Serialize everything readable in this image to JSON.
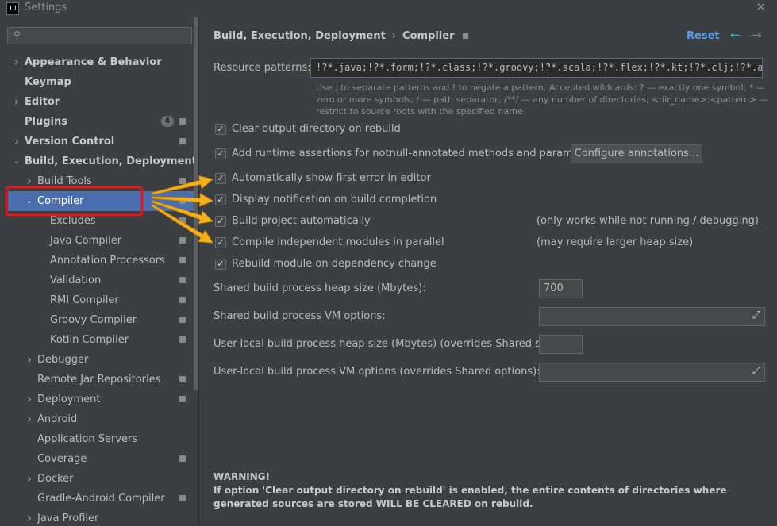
{
  "window": {
    "title": "Settings",
    "app_icon_text": "IJ"
  },
  "sidebar": {
    "search": {
      "placeholder": "",
      "icon": "search-icon"
    },
    "items": [
      {
        "label": "Appearance & Behavior",
        "level": 0,
        "arrow": "right",
        "bold": true
      },
      {
        "label": "Keymap",
        "level": 0,
        "arrow": "",
        "bold": true
      },
      {
        "label": "Editor",
        "level": 0,
        "arrow": "right",
        "bold": true
      },
      {
        "label": "Plugins",
        "level": 0,
        "arrow": "",
        "bold": true,
        "badge": "4",
        "project": true
      },
      {
        "label": "Version Control",
        "level": 0,
        "arrow": "right",
        "bold": true,
        "project": true
      },
      {
        "label": "Build, Execution, Deployment",
        "level": 0,
        "arrow": "down",
        "bold": true
      },
      {
        "label": "Build Tools",
        "level": 1,
        "arrow": "right",
        "project": true
      },
      {
        "label": "Compiler",
        "level": 1,
        "arrow": "down",
        "selected": true,
        "project": true
      },
      {
        "label": "Excludes",
        "level": 2,
        "arrow": "",
        "project": true
      },
      {
        "label": "Java Compiler",
        "level": 2,
        "arrow": "",
        "project": true
      },
      {
        "label": "Annotation Processors",
        "level": 2,
        "arrow": "",
        "project": true
      },
      {
        "label": "Validation",
        "level": 2,
        "arrow": "",
        "project": true
      },
      {
        "label": "RMI Compiler",
        "level": 2,
        "arrow": "",
        "project": true
      },
      {
        "label": "Groovy Compiler",
        "level": 2,
        "arrow": "",
        "project": true
      },
      {
        "label": "Kotlin Compiler",
        "level": 2,
        "arrow": "",
        "project": true
      },
      {
        "label": "Debugger",
        "level": 1,
        "arrow": "right"
      },
      {
        "label": "Remote Jar Repositories",
        "level": 1,
        "arrow": "",
        "project": true
      },
      {
        "label": "Deployment",
        "level": 1,
        "arrow": "right",
        "project": true
      },
      {
        "label": "Android",
        "level": 1,
        "arrow": "right"
      },
      {
        "label": "Application Servers",
        "level": 1,
        "arrow": ""
      },
      {
        "label": "Coverage",
        "level": 1,
        "arrow": "",
        "project": true
      },
      {
        "label": "Docker",
        "level": 1,
        "arrow": "right"
      },
      {
        "label": "Gradle-Android Compiler",
        "level": 1,
        "arrow": "",
        "project": true
      },
      {
        "label": "Java Profiler",
        "level": 1,
        "arrow": "right"
      }
    ]
  },
  "header": {
    "breadcrumb_parent": "Build, Execution, Deployment",
    "breadcrumb_sep": "›",
    "breadcrumb_current": "Compiler",
    "reset_label": "Reset",
    "back_arrow": "←",
    "forward_arrow": "→"
  },
  "resource_patterns": {
    "label": "Resource patterns:",
    "value": "!?*.java;!?*.form;!?*.class;!?*.groovy;!?*.scala;!?*.flex;!?*.kt;!?*.clj;!?*.aj",
    "hint": "Use ; to separate patterns and ! to negate a pattern. Accepted wildcards: ? — exactly one symbol; * — zero or more symbols; / — path separator; /**/ — any number of directories; <dir_name>:<pattern> — restrict to source roots with the specified name"
  },
  "options": [
    {
      "label": "Clear output directory on rebuild",
      "checked": true
    },
    {
      "label": "Add runtime assertions for notnull-annotated methods and parameters",
      "checked": true
    },
    {
      "label": "Automatically show first error in editor",
      "checked": true
    },
    {
      "label": "Display notification on build completion",
      "checked": true
    },
    {
      "label": "Build project automatically",
      "checked": true,
      "note": "(only works while not running / debugging)"
    },
    {
      "label": "Compile independent modules in parallel",
      "checked": true,
      "note": "(may require larger heap size)"
    },
    {
      "label": "Rebuild module on dependency change",
      "checked": true
    }
  ],
  "configure_annotations_label": "Configure annotations...",
  "fields": {
    "heap_label": "Shared build process heap size (Mbytes):",
    "heap_value": "700",
    "vm_label": "Shared build process VM options:",
    "vm_value": "",
    "local_heap_label": "User-local build process heap size (Mbytes) (overrides Shared size):",
    "local_heap_value": "",
    "local_vm_label": "User-local build process VM options (overrides Shared options):",
    "local_vm_value": ""
  },
  "warning": {
    "title": "WARNING!",
    "text": "If option 'Clear output directory on rebuild' is enabled, the entire contents of directories where generated sources are stored WILL BE CLEARED on rebuild."
  },
  "annotation_colors": {
    "highlight_box": "#e8151b",
    "arrow": "#f2b21b",
    "selection": "#4b6eaf",
    "link": "#589df6"
  }
}
